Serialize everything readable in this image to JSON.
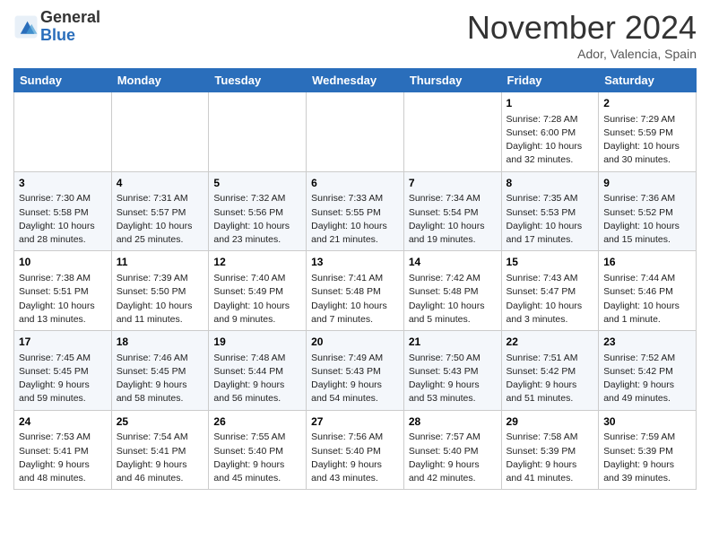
{
  "logo": {
    "general": "General",
    "blue": "Blue"
  },
  "title": "November 2024",
  "location": "Ador, Valencia, Spain",
  "days_of_week": [
    "Sunday",
    "Monday",
    "Tuesday",
    "Wednesday",
    "Thursday",
    "Friday",
    "Saturday"
  ],
  "weeks": [
    [
      {
        "day": "",
        "info": ""
      },
      {
        "day": "",
        "info": ""
      },
      {
        "day": "",
        "info": ""
      },
      {
        "day": "",
        "info": ""
      },
      {
        "day": "",
        "info": ""
      },
      {
        "day": "1",
        "info": "Sunrise: 7:28 AM\nSunset: 6:00 PM\nDaylight: 10 hours\nand 32 minutes."
      },
      {
        "day": "2",
        "info": "Sunrise: 7:29 AM\nSunset: 5:59 PM\nDaylight: 10 hours\nand 30 minutes."
      }
    ],
    [
      {
        "day": "3",
        "info": "Sunrise: 7:30 AM\nSunset: 5:58 PM\nDaylight: 10 hours\nand 28 minutes."
      },
      {
        "day": "4",
        "info": "Sunrise: 7:31 AM\nSunset: 5:57 PM\nDaylight: 10 hours\nand 25 minutes."
      },
      {
        "day": "5",
        "info": "Sunrise: 7:32 AM\nSunset: 5:56 PM\nDaylight: 10 hours\nand 23 minutes."
      },
      {
        "day": "6",
        "info": "Sunrise: 7:33 AM\nSunset: 5:55 PM\nDaylight: 10 hours\nand 21 minutes."
      },
      {
        "day": "7",
        "info": "Sunrise: 7:34 AM\nSunset: 5:54 PM\nDaylight: 10 hours\nand 19 minutes."
      },
      {
        "day": "8",
        "info": "Sunrise: 7:35 AM\nSunset: 5:53 PM\nDaylight: 10 hours\nand 17 minutes."
      },
      {
        "day": "9",
        "info": "Sunrise: 7:36 AM\nSunset: 5:52 PM\nDaylight: 10 hours\nand 15 minutes."
      }
    ],
    [
      {
        "day": "10",
        "info": "Sunrise: 7:38 AM\nSunset: 5:51 PM\nDaylight: 10 hours\nand 13 minutes."
      },
      {
        "day": "11",
        "info": "Sunrise: 7:39 AM\nSunset: 5:50 PM\nDaylight: 10 hours\nand 11 minutes."
      },
      {
        "day": "12",
        "info": "Sunrise: 7:40 AM\nSunset: 5:49 PM\nDaylight: 10 hours\nand 9 minutes."
      },
      {
        "day": "13",
        "info": "Sunrise: 7:41 AM\nSunset: 5:48 PM\nDaylight: 10 hours\nand 7 minutes."
      },
      {
        "day": "14",
        "info": "Sunrise: 7:42 AM\nSunset: 5:48 PM\nDaylight: 10 hours\nand 5 minutes."
      },
      {
        "day": "15",
        "info": "Sunrise: 7:43 AM\nSunset: 5:47 PM\nDaylight: 10 hours\nand 3 minutes."
      },
      {
        "day": "16",
        "info": "Sunrise: 7:44 AM\nSunset: 5:46 PM\nDaylight: 10 hours\nand 1 minute."
      }
    ],
    [
      {
        "day": "17",
        "info": "Sunrise: 7:45 AM\nSunset: 5:45 PM\nDaylight: 9 hours\nand 59 minutes."
      },
      {
        "day": "18",
        "info": "Sunrise: 7:46 AM\nSunset: 5:45 PM\nDaylight: 9 hours\nand 58 minutes."
      },
      {
        "day": "19",
        "info": "Sunrise: 7:48 AM\nSunset: 5:44 PM\nDaylight: 9 hours\nand 56 minutes."
      },
      {
        "day": "20",
        "info": "Sunrise: 7:49 AM\nSunset: 5:43 PM\nDaylight: 9 hours\nand 54 minutes."
      },
      {
        "day": "21",
        "info": "Sunrise: 7:50 AM\nSunset: 5:43 PM\nDaylight: 9 hours\nand 53 minutes."
      },
      {
        "day": "22",
        "info": "Sunrise: 7:51 AM\nSunset: 5:42 PM\nDaylight: 9 hours\nand 51 minutes."
      },
      {
        "day": "23",
        "info": "Sunrise: 7:52 AM\nSunset: 5:42 PM\nDaylight: 9 hours\nand 49 minutes."
      }
    ],
    [
      {
        "day": "24",
        "info": "Sunrise: 7:53 AM\nSunset: 5:41 PM\nDaylight: 9 hours\nand 48 minutes."
      },
      {
        "day": "25",
        "info": "Sunrise: 7:54 AM\nSunset: 5:41 PM\nDaylight: 9 hours\nand 46 minutes."
      },
      {
        "day": "26",
        "info": "Sunrise: 7:55 AM\nSunset: 5:40 PM\nDaylight: 9 hours\nand 45 minutes."
      },
      {
        "day": "27",
        "info": "Sunrise: 7:56 AM\nSunset: 5:40 PM\nDaylight: 9 hours\nand 43 minutes."
      },
      {
        "day": "28",
        "info": "Sunrise: 7:57 AM\nSunset: 5:40 PM\nDaylight: 9 hours\nand 42 minutes."
      },
      {
        "day": "29",
        "info": "Sunrise: 7:58 AM\nSunset: 5:39 PM\nDaylight: 9 hours\nand 41 minutes."
      },
      {
        "day": "30",
        "info": "Sunrise: 7:59 AM\nSunset: 5:39 PM\nDaylight: 9 hours\nand 39 minutes."
      }
    ]
  ]
}
